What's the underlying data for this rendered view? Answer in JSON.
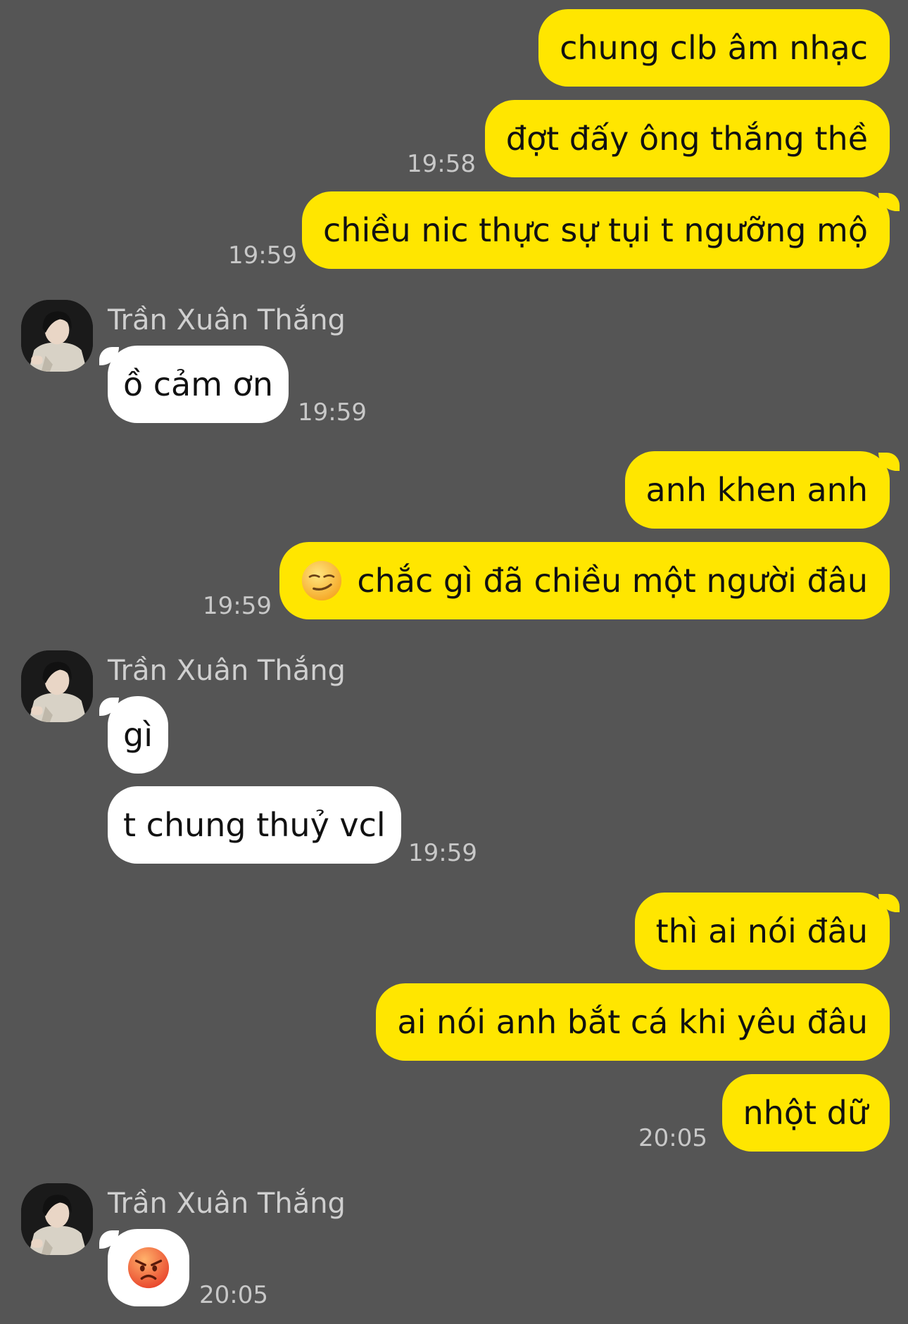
{
  "contact": {
    "name": "Trần Xuân Thắng",
    "avatar_icon": "contact-avatar-photo"
  },
  "colors": {
    "background": "#555555",
    "my_bubble": "#FFE600",
    "their_bubble": "#FFFFFF",
    "timestamp": "#C8C8C8"
  },
  "messages": [
    {
      "sender": "me",
      "text": "chung clb âm nhạc"
    },
    {
      "sender": "me",
      "text": "đợt đấy ông thắng thề",
      "time": "19:58"
    },
    {
      "sender": "me",
      "text": "chiều nic thực sự tụi t ngưỡng mộ",
      "time": "19:59"
    },
    {
      "sender": "them",
      "text": "ồ cảm ơn",
      "time": "19:59"
    },
    {
      "sender": "me",
      "text": "anh khen anh"
    },
    {
      "sender": "me",
      "emoji": "smirk-emoji",
      "text": "chắc gì đã chiều một người đâu",
      "time": "19:59"
    },
    {
      "sender": "them",
      "text": "gì"
    },
    {
      "sender": "them",
      "text": "t chung thuỷ vcl",
      "time": "19:59"
    },
    {
      "sender": "me",
      "text": "thì ai nói đâu"
    },
    {
      "sender": "me",
      "text": "ai nói anh bắt cá khi yêu đâu"
    },
    {
      "sender": "me",
      "text": "nhột dữ",
      "time": "20:05"
    },
    {
      "sender": "them",
      "emoji": "angry-face-emoji",
      "time": "20:05"
    }
  ]
}
